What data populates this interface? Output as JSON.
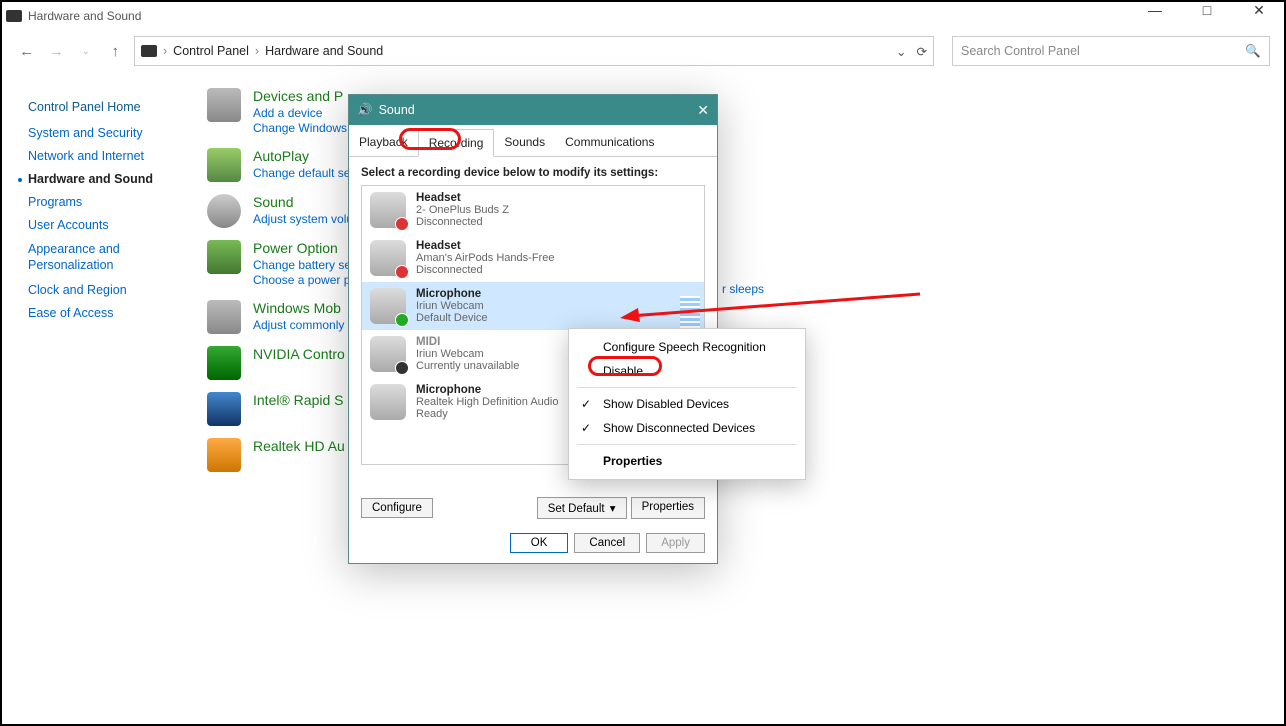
{
  "window": {
    "title": "Hardware and Sound"
  },
  "winctrls": {
    "min": "—",
    "max": "□",
    "close": "✕"
  },
  "nav": {
    "back": "←",
    "fwd": "→",
    "up": "↑"
  },
  "address": {
    "icon": "cp-icon",
    "root": "Control Panel",
    "current": "Hardware and Sound",
    "dropdown": "⌄",
    "refresh": "⟳"
  },
  "search": {
    "placeholder": "Search Control Panel",
    "icon": "🔍"
  },
  "sidebar": {
    "header": "Control Panel Home",
    "items": [
      {
        "label": "System and Security"
      },
      {
        "label": "Network and Internet"
      },
      {
        "label": "Hardware and Sound",
        "active": true
      },
      {
        "label": "Programs"
      },
      {
        "label": "User Accounts"
      },
      {
        "label": "Appearance and Personalization"
      },
      {
        "label": "Clock and Region"
      },
      {
        "label": "Ease of Access"
      }
    ]
  },
  "categories": [
    {
      "title": "Devices and P",
      "links": [
        "Add a device",
        "Change Windows"
      ]
    },
    {
      "title": "AutoPlay",
      "links": [
        "Change default set"
      ]
    },
    {
      "title": "Sound",
      "links": [
        "Adjust system volu"
      ]
    },
    {
      "title": "Power Option",
      "links": [
        "Change battery set",
        "Choose a power pl"
      ]
    },
    {
      "title": "Windows Mob",
      "links": [
        "Adjust commonly"
      ]
    },
    {
      "title": "NVIDIA Contro",
      "links": []
    },
    {
      "title": "Intel® Rapid S",
      "links": []
    },
    {
      "title": "Realtek HD Au",
      "links": []
    }
  ],
  "extra_link": "r sleeps",
  "dialog": {
    "title": "Sound",
    "close": "✕",
    "tabs": [
      "Playback",
      "Recording",
      "Sounds",
      "Communications"
    ],
    "active_tab": 1,
    "instruction": "Select a recording device below to modify its settings:",
    "devices": [
      {
        "title": "Headset",
        "sub1": "2- OnePlus Buds Z",
        "sub2": "Disconnected",
        "badge": "#d33"
      },
      {
        "title": "Headset",
        "sub1": "Aman's AirPods Hands-Free",
        "sub2": "Disconnected",
        "badge": "#d33"
      },
      {
        "title": "Microphone",
        "sub1": "Iriun Webcam",
        "sub2": "Default Device",
        "badge": "#2a2",
        "selected": true
      },
      {
        "title": "MIDI",
        "sub1": "Iriun Webcam",
        "sub2": "Currently unavailable",
        "badge": "#333",
        "grey": true
      },
      {
        "title": "Microphone",
        "sub1": "Realtek High Definition Audio",
        "sub2": "Ready",
        "badge": ""
      }
    ],
    "buttons": {
      "configure": "Configure",
      "setdefault": "Set Default",
      "setdefault_arrow": "▾",
      "properties": "Properties"
    },
    "ok": "OK",
    "cancel": "Cancel",
    "apply": "Apply"
  },
  "context_menu": {
    "items": [
      {
        "label": "Configure Speech Recognition"
      },
      {
        "label": "Disable",
        "highlight": true
      },
      {
        "separator": true
      },
      {
        "label": "Show Disabled Devices",
        "check": true
      },
      {
        "label": "Show Disconnected Devices",
        "check": true
      },
      {
        "separator": true
      },
      {
        "label": "Properties",
        "bold": true
      }
    ]
  }
}
